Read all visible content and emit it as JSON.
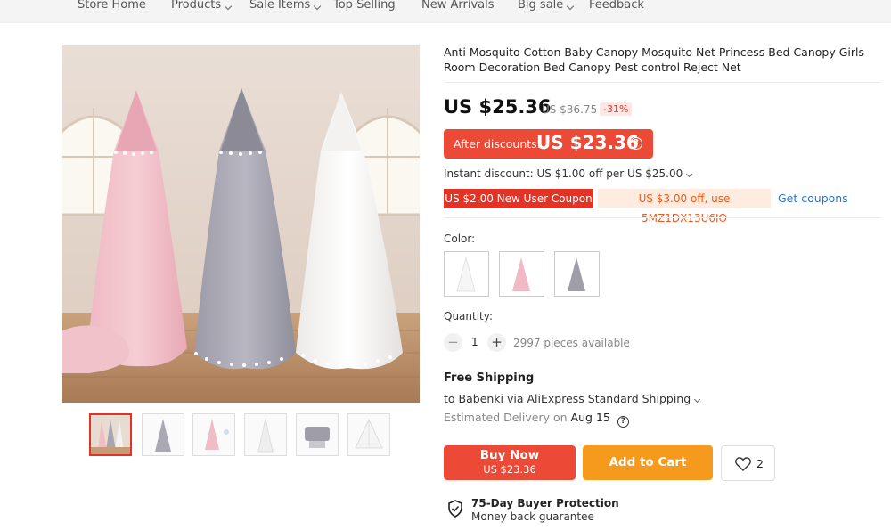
{
  "nav": {
    "items": [
      {
        "label": "Store Home",
        "dropdown": false
      },
      {
        "label": "Products",
        "dropdown": true
      },
      {
        "label": "Sale Items",
        "dropdown": true
      },
      {
        "label": "Top Selling",
        "dropdown": false
      },
      {
        "label": "New Arrivals",
        "dropdown": false
      },
      {
        "label": "Big sale",
        "dropdown": true
      },
      {
        "label": "Feedback",
        "dropdown": false
      }
    ]
  },
  "product": {
    "title": "Anti Mosquito Cotton Baby Canopy Mosquito Net Princess Bed Canopy Girls Room Decoration Bed Canopy Pest control Reject Net",
    "price": "US $25.36",
    "original_price": "US $36.75",
    "discount_badge": "-31%",
    "after_discount_label": "After discounts:",
    "after_discount_price": "US $23.36",
    "instant_discount": "Instant discount: US $1.00 off per US $25.00",
    "coupon_new_user": "US $2.00 New User Coupon",
    "coupon_code": "US $3.00 off, use 5MZ1DX13U6IO",
    "get_coupons": "Get coupons"
  },
  "color": {
    "label": "Color:",
    "options": [
      "white-canopy",
      "pink-canopy",
      "grey-canopy"
    ]
  },
  "quantity": {
    "label": "Quantity:",
    "value": "1",
    "minus": "−",
    "plus": "+",
    "available": "2997 pieces available"
  },
  "shipping": {
    "title": "Free Shipping",
    "to": "to Babenki via AliExpress Standard Shipping",
    "estimated_label": "Estimated Delivery on",
    "estimated_date": "Aug 15"
  },
  "actions": {
    "buy_now": "Buy Now",
    "buy_now_price": "US $23.36",
    "add_to_cart": "Add to Cart",
    "wishlist_count": "2"
  },
  "protection": {
    "title": "75-Day Buyer Protection",
    "subtitle": "Money back guarantee"
  },
  "colors": {
    "accent_red": "#ec4a36",
    "cart_orange": "#f59a1c",
    "link_blue": "#2f75c5"
  }
}
